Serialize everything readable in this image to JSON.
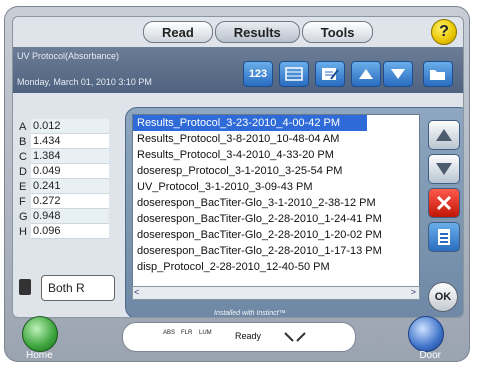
{
  "tabs": [
    {
      "label": "Read"
    },
    {
      "label": "Results"
    },
    {
      "label": "Tools"
    }
  ],
  "help": {
    "label": "?"
  },
  "header": {
    "protocol": "UV Protocol(Absorbance)",
    "date": "Monday, March 01, 2010 3:10 PM"
  },
  "toolbar": [
    {
      "icon": "numbers-123-icon",
      "label": "123"
    },
    {
      "icon": "grid-view-icon"
    },
    {
      "icon": "edit-note-icon"
    },
    {
      "icon": "arrow-up-icon"
    },
    {
      "icon": "arrow-down-icon"
    },
    {
      "icon": "folder-open-icon"
    }
  ],
  "plate": [
    {
      "label": "A",
      "value": "0.012"
    },
    {
      "label": "B",
      "value": "1.434"
    },
    {
      "label": "C",
      "value": "1.384"
    },
    {
      "label": "D",
      "value": "0.049"
    },
    {
      "label": "E",
      "value": "0.241"
    },
    {
      "label": "F",
      "value": "0.272"
    },
    {
      "label": "G",
      "value": "0.948"
    },
    {
      "label": "H",
      "value": "0.096"
    }
  ],
  "both": {
    "text": "Both R"
  },
  "dialog": {
    "files": [
      "Results_Protocol_3-23-2010_4-00-42 PM",
      "Results_Protocol_3-8-2010_10-48-04 AM",
      "Results_Protocol_3-4-2010_4-33-20 PM",
      "doseresp_Protocol_3-1-2010_3-25-54 PM",
      "UV_Protocol_3-1-2010_3-09-43 PM",
      "doserespon_BacTiter-Glo_3-1-2010_2-38-12 PM",
      "doserespon_BacTiter-Glo_2-28-2010_1-24-41 PM",
      "doserespon_BacTiter-Glo_2-28-2010_1-20-02 PM",
      "doserespon_BacTiter-Glo_2-28-2010_1-17-13 PM",
      "disp_Protocol_2-28-2010_12-40-50 PM"
    ],
    "scroll_left": "<",
    "scroll_right": ">",
    "ok_label": "OK"
  },
  "bottom": {
    "home": "Home",
    "door": "Door",
    "installed": "Installed with Instinct™",
    "ready": "Ready",
    "indicators": [
      "ABS",
      "FLR",
      "LUM"
    ]
  },
  "colors": {
    "selection": "#2f6bd8",
    "header": "#5a6d88",
    "delete": "#d9261b",
    "accent": "#2a6cc0"
  }
}
